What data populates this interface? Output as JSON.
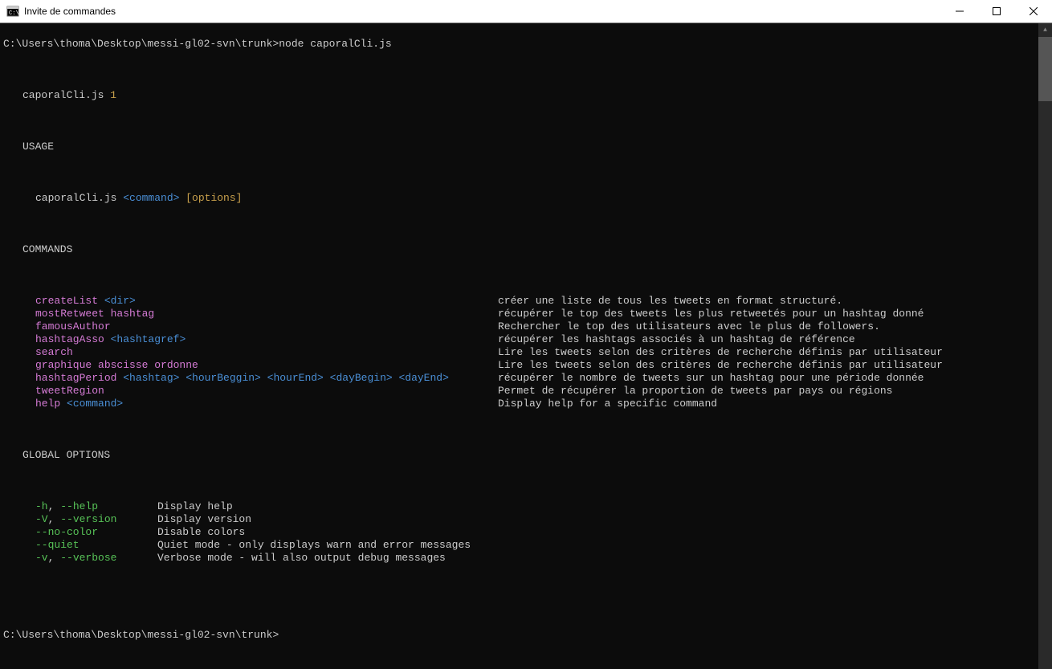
{
  "window": {
    "title": "Invite de commandes"
  },
  "prompt1": "C:\\Users\\thoma\\Desktop\\messi-gl02-svn\\trunk>node caporalCli.js",
  "prompt2": "C:\\Users\\thoma\\Desktop\\messi-gl02-svn\\trunk>",
  "header": {
    "name": "caporalCli.js",
    "ver": "1"
  },
  "sections": {
    "usage": "USAGE",
    "commands": "COMMANDS",
    "globalOptions": "GLOBAL OPTIONS"
  },
  "usageLine": {
    "prog": "caporalCli.js ",
    "cmd": "<command>",
    "opts": " [options]"
  },
  "commands": [
    {
      "name": "createList ",
      "arg": "<dir>",
      "desc": "créer une liste de tous les tweets en format structuré."
    },
    {
      "name": "mostRetweet hashtag",
      "arg": "",
      "desc": "récupérer le top des tweets les plus retweetés pour un hashtag donné"
    },
    {
      "name": "famousAuthor",
      "arg": "",
      "desc": "Rechercher le top des utilisateurs avec le plus de followers."
    },
    {
      "name": "hashtagAsso ",
      "arg": "<hashtagref>",
      "desc": "récupérer les hashtags associés à un hashtag de référence"
    },
    {
      "name": "search",
      "arg": "",
      "desc": "Lire les tweets selon des critères de recherche définis par utilisateur"
    },
    {
      "name": "graphique abscisse ordonne",
      "arg": "",
      "desc": "Lire les tweets selon des critères de recherche définis par utilisateur"
    },
    {
      "name": "hashtagPeriod ",
      "arg": "<hashtag> <hourBeggin> <hourEnd> <dayBegin> <dayEnd>",
      "desc": "récupérer le nombre de tweets sur un hashtag pour une période donnée"
    },
    {
      "name": "tweetRegion",
      "arg": "",
      "desc": "Permet de récupérer la proportion de tweets par pays ou régions"
    },
    {
      "name": "help ",
      "arg": "<command>",
      "desc": "Display help for a specific command"
    }
  ],
  "globalOptions": [
    {
      "short": "-h",
      "sep": ", ",
      "long": "--help",
      "desc": "Display help"
    },
    {
      "short": "-V",
      "sep": ", ",
      "long": "--version",
      "desc": "Display version"
    },
    {
      "short": "",
      "sep": "",
      "long": "--no-color",
      "desc": "Disable colors"
    },
    {
      "short": "",
      "sep": "",
      "long": "--quiet",
      "desc": "Quiet mode - only displays warn and error messages"
    },
    {
      "short": "-v",
      "sep": ", ",
      "long": "--verbose",
      "desc": "Verbose mode - will also output debug messages"
    }
  ]
}
